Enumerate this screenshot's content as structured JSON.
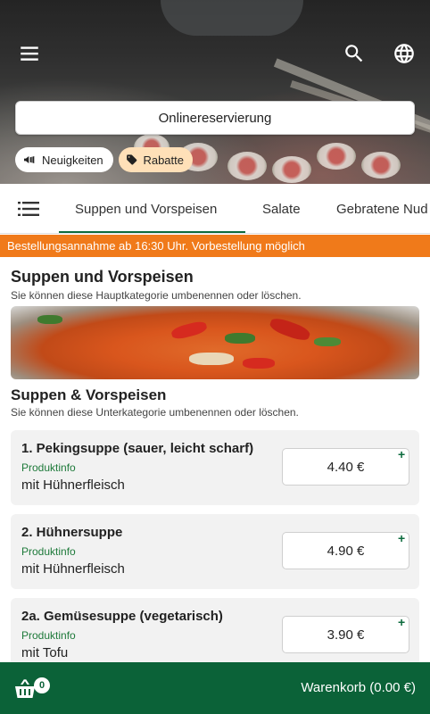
{
  "header": {
    "menu_icon": "menu-icon",
    "search_icon": "search-icon",
    "language_icon": "globe-icon",
    "reserve_button": "Onlinereservierung",
    "chips": [
      {
        "label": "Neuigkeiten",
        "icon": "megaphone-icon"
      },
      {
        "label": "Rabatte",
        "icon": "tag-icon",
        "color": "#ffe0b8"
      }
    ]
  },
  "tabs": {
    "list_icon": "list-icon",
    "items": [
      {
        "label": "Suppen und Vorspeisen",
        "active": true
      },
      {
        "label": "Salate",
        "active": false
      },
      {
        "label": "Gebratene Nud",
        "active": false
      }
    ],
    "active_color": "#0d6b3e"
  },
  "notice": {
    "text": "Bestellungsannahme ab 16:30 Uhr. Vorbestellung möglich",
    "color": "#f07a1a"
  },
  "category": {
    "title": "Suppen und Vorspeisen",
    "subtitle": "Sie können diese Hauptkategorie umbenennen oder löschen."
  },
  "subcategory": {
    "title": "Suppen & Vorspeisen",
    "subtitle": "Sie können diese Unterkategorie umbenennen oder löschen."
  },
  "items": [
    {
      "name": "1. Pekingsuppe (sauer, leicht scharf)",
      "info": "Produktinfo",
      "desc": "mit Hühnerfleisch",
      "price": "4.40 €"
    },
    {
      "name": "2. Hühnersuppe",
      "info": "Produktinfo",
      "desc": "mit Hühnerfleisch",
      "price": "4.90 €"
    },
    {
      "name": "2a. Gemüsesuppe (vegetarisch)",
      "info": "Produktinfo",
      "desc": "mit Tofu",
      "price": "3.90 €"
    }
  ],
  "cart": {
    "icon": "basket-icon",
    "count": "0",
    "label": "Warenkorb (0.00 €)",
    "color": "#0b6238"
  }
}
